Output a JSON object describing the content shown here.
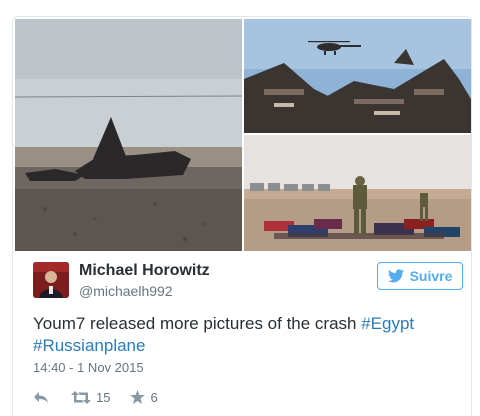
{
  "tweet": {
    "author_name": "Michael Horowitz",
    "author_handle": "@michaelh992",
    "follow_label": "Suivre",
    "text_plain": "Youm7 released more pictures of the crash ",
    "hashtag_egypt": "#Egypt",
    "hashtag_plane": "#Russianplane",
    "timestamp": "14:40 - 1 Nov 2015",
    "retweet_count": "15",
    "favorite_count": "6"
  },
  "colors": {
    "twitter_blue": "#55acee",
    "link_blue": "#2b7bb9",
    "muted_gray": "#66757f",
    "text_dark": "#292f33"
  },
  "icons": {
    "follow": "twitter-bird-icon",
    "reply": "reply-arrow-icon",
    "retweet": "retweet-icon",
    "favorite": "star-icon"
  }
}
